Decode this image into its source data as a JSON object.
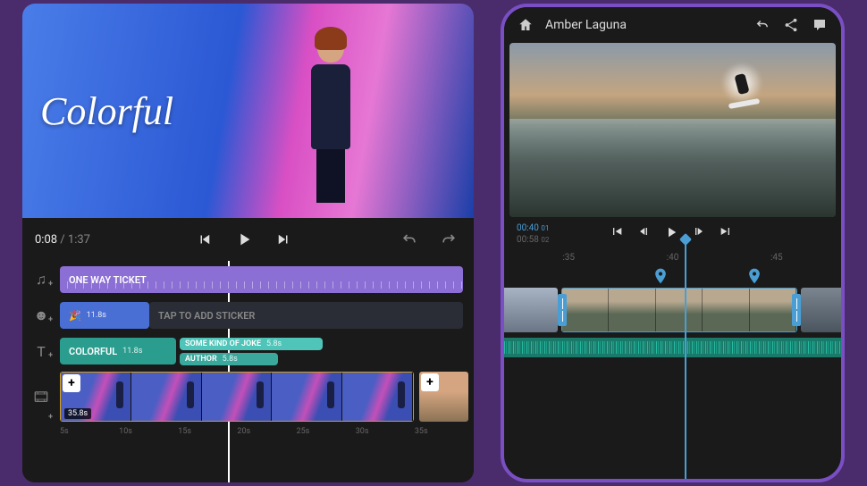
{
  "left": {
    "preview_title": "Colorful",
    "playback": {
      "current": "0:08",
      "total": "1:37"
    },
    "tracks": {
      "music": {
        "label": "ONE WAY TICKET"
      },
      "sticker": {
        "duration": "11.8s",
        "placeholder": "TAP TO ADD STICKER"
      },
      "text": {
        "main_label": "COLORFUL",
        "main_dur": "11.8s",
        "sub1_label": "SOME KIND OF JOKE",
        "sub1_dur": "5.8s",
        "sub2_label": "AUTHOR",
        "sub2_dur": "5.8s"
      },
      "video": {
        "clip_duration": "35.8s"
      }
    },
    "ruler": [
      "5s",
      "10s",
      "15s",
      "20s",
      "25s",
      "30s",
      "35s"
    ]
  },
  "right": {
    "project_name": "Amber Laguna",
    "timecode": {
      "current": "00:40",
      "frame": "01",
      "total": "00:58",
      "total_frame": "02"
    },
    "ruler": [
      ":35",
      ":40",
      ":45"
    ]
  }
}
